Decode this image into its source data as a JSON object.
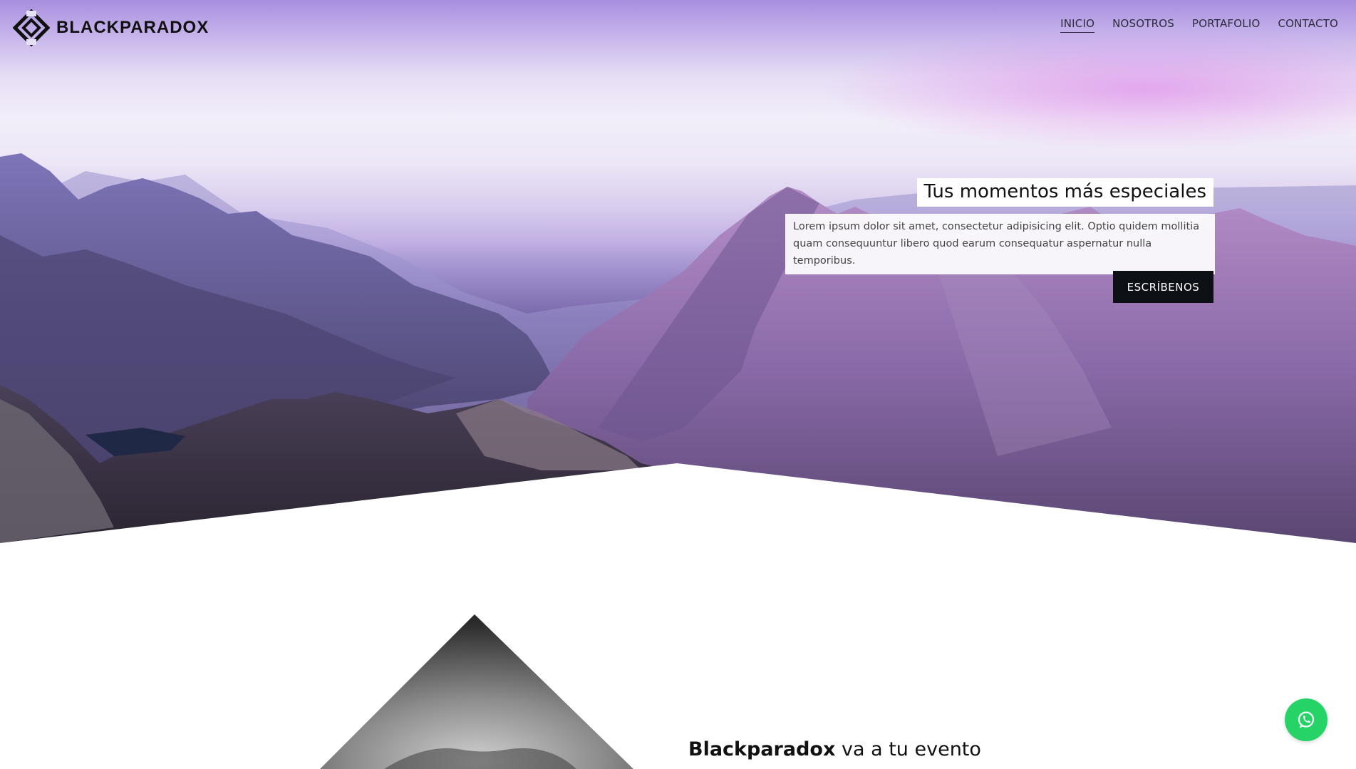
{
  "brand": {
    "name": "BLACKPARADOX"
  },
  "nav": {
    "items": [
      {
        "label": "INICIO",
        "active": true
      },
      {
        "label": "NOSOTROS",
        "active": false
      },
      {
        "label": "PORTAFOLIO",
        "active": false
      },
      {
        "label": "CONTACTO",
        "active": false
      }
    ]
  },
  "hero": {
    "title": "Tus momentos más especiales",
    "description": "Lorem ipsum dolor sit amet, consectetur adipisicing elit. Optio quidem mollitia quam consequuntur libero quod earum consequatur aspernatur nulla temporibus.",
    "cta_label": "ESCRÍBENOS"
  },
  "section": {
    "title_bold": "Blackparadox",
    "title_rest": " va a tu evento"
  },
  "icons": {
    "logo": "logo-diamond-icon",
    "whatsapp": "whatsapp-icon"
  },
  "colors": {
    "cta_background": "#0d1014",
    "whatsapp_green": "#25d366"
  }
}
